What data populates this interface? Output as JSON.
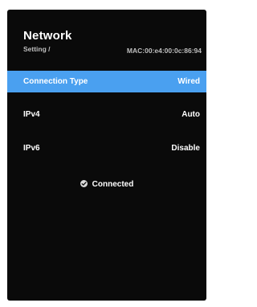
{
  "header": {
    "title": "Network",
    "breadcrumb": "Setting /",
    "mac": "MAC:00:e4:00:0c:86:94"
  },
  "settings": [
    {
      "label": "Connection Type",
      "value": "Wired",
      "selected": true
    },
    {
      "label": "IPv4",
      "value": "Auto",
      "selected": false
    },
    {
      "label": "IPv6",
      "value": "Disable",
      "selected": false
    }
  ],
  "status": {
    "icon": "check-circle-icon",
    "text": "Connected"
  },
  "colors": {
    "background": "#0a0a0a",
    "highlight": "#4aa0f0",
    "text": "#ffffff",
    "subtext": "#bfbfbf"
  }
}
